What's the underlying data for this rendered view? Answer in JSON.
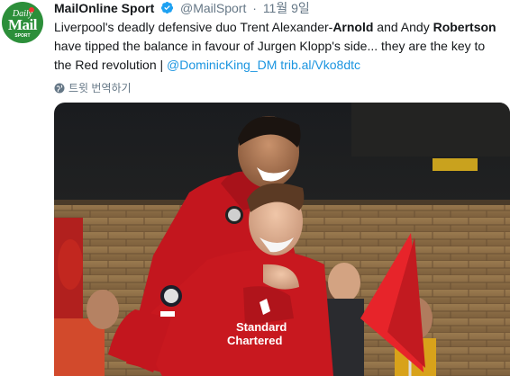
{
  "avatar": {
    "line1": "Daily",
    "line2": "Mail",
    "line3": "SPORT"
  },
  "tweet": {
    "display_name": "MailOnline Sport",
    "handle": "@MailSport",
    "separator": "·",
    "date": "11월 9일",
    "text_parts": [
      "Liverpool's deadly defensive duo Trent Alexander-",
      "Arnold",
      " and Andy ",
      "Robertson",
      " have tipped the balance in favour of Jurgen Klopp's side... they are the key to the Red revolution | "
    ],
    "mention": "@DominicKing_DM",
    "url": "trib.al/Vko8dtc",
    "translate_label": "트윗 번역하기"
  },
  "photo": {
    "shirt_sponsor_line1": "Standard",
    "shirt_sponsor_line2": "Chartered"
  },
  "colors": {
    "brand_green": "#2c8f3a",
    "link_blue": "#1b95e0",
    "verified_blue": "#1da1f2",
    "muted": "#657786"
  }
}
